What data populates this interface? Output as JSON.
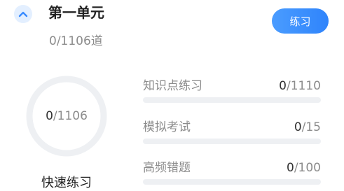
{
  "unit": {
    "title": "第一单元",
    "progress_text": "0/1106道",
    "expanded": true
  },
  "practice_button": {
    "label": "练习"
  },
  "quick_practice": {
    "done": "0",
    "total": "/1106",
    "label": "快速练习",
    "fraction": 0
  },
  "stats": [
    {
      "label": "知识点练习",
      "done": "0",
      "total": "/1110",
      "fraction": 0
    },
    {
      "label": "模拟考试",
      "done": "0",
      "total": "/15",
      "fraction": 0
    },
    {
      "label": "高频错题",
      "done": "0",
      "total": "/100",
      "fraction": 0
    }
  ],
  "colors": {
    "accent": "#3a8cff",
    "track": "#eef0f3",
    "toggle_bg": "#e3efff"
  },
  "icons": {
    "toggle": "chevron-up-icon"
  }
}
